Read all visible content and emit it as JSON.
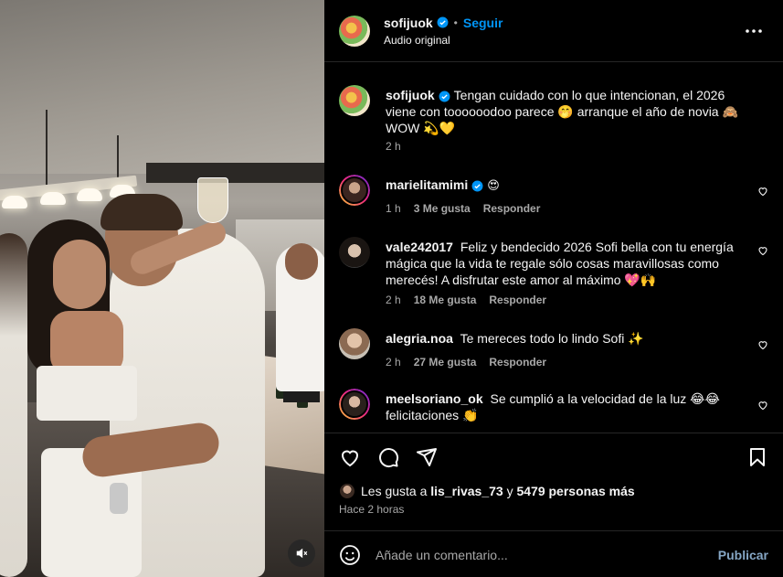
{
  "colors": {
    "accent": "#0095f6",
    "background": "#000000",
    "muted": "#a8a8a8",
    "divider": "#262626"
  },
  "header": {
    "username": "sofijuok",
    "dot": "•",
    "follow_label": "Seguir",
    "subtitle": "Audio original"
  },
  "caption": {
    "username": "sofijuok",
    "text": "Tengan cuidado con lo que intencionan, el 2026 viene con toooooodoo parece 🤭 arranque el año de novia 🙈 WOW 💫💛",
    "time": "2 h"
  },
  "comments": [
    {
      "username": "marielitamimi",
      "verified": true,
      "text": "😍",
      "time": "1 h",
      "likes": "3 Me gusta",
      "reply": "Responder"
    },
    {
      "username": "vale242017",
      "verified": false,
      "text": "Feliz y bendecido 2026 Sofi bella con tu energía mágica que la vida te regale sólo cosas maravillosas como merecés! A disfrutar este amor al máximo 💖🙌",
      "time": "2 h",
      "likes": "18 Me gusta",
      "reply": "Responder"
    },
    {
      "username": "alegria.noa",
      "verified": false,
      "text": "Te mereces todo lo lindo Sofi ✨",
      "time": "2 h",
      "likes": "27 Me gusta",
      "reply": "Responder"
    },
    {
      "username": "meelsoriano_ok",
      "verified": false,
      "text": "Se cumplió a la velocidad de la luz 😂😂 felicitaciones 👏",
      "time": "",
      "likes": "",
      "reply": ""
    }
  ],
  "likes": {
    "prefix": "Les gusta a",
    "user": "lis_rivas_73",
    "connector": "y",
    "others": "5479 personas más"
  },
  "posted": "Hace 2 horas",
  "composer": {
    "placeholder": "Añade un comentario...",
    "publish_label": "Publicar"
  },
  "icons": [
    "more-icon",
    "verified-icon",
    "heart-icon",
    "comment-icon",
    "share-icon",
    "save-icon",
    "emoji-icon",
    "mute-icon"
  ]
}
